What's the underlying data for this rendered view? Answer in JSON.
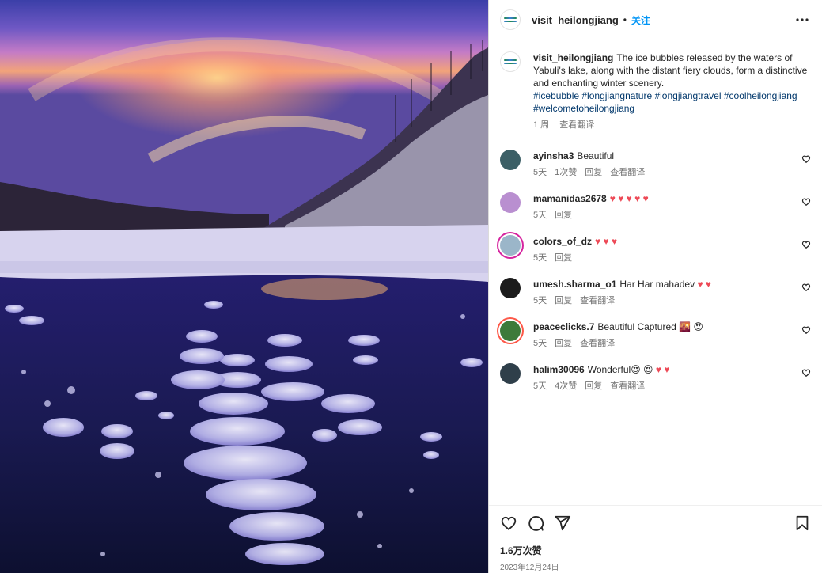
{
  "account": {
    "username": "visit_heilongjiang",
    "follow_label": "关注"
  },
  "caption": {
    "username": "visit_heilongjiang",
    "text": "The ice bubbles released by the waters of Yabuli's lake, along with the distant fiery clouds, form a distinctive and enchanting winter scenery.",
    "hashtags": "#icebubble #longjiangnature #longjiangtravel #coolheilongjiang #welcometoheilongjiang",
    "time": "1 周",
    "translate_label": "查看翻译"
  },
  "comments": [
    {
      "username": "ayinsha3",
      "text": "Beautiful",
      "time": "5天",
      "likes": "1次赞",
      "reply": "回复",
      "translate": "查看翻译",
      "avatar_color": "#3c5f66"
    },
    {
      "username": "mamanidas2678",
      "text": "♥ ♥ ♥ ♥ ♥",
      "time": "5天",
      "likes": "",
      "reply": "回复",
      "translate": "",
      "avatar_color": "#b98fd0"
    },
    {
      "username": "colors_of_dz",
      "text": "♥ ♥ ♥",
      "time": "5天",
      "likes": "",
      "reply": "回复",
      "translate": "",
      "avatar_color": "#9bb6c9"
    },
    {
      "username": "umesh.sharma_o1",
      "text": "Har Har mahadev ♥ ♥",
      "time": "5天",
      "likes": "",
      "reply": "回复",
      "translate": "查看翻译",
      "avatar_color": "#1c1c1c"
    },
    {
      "username": "peaceclicks.7",
      "text": "Beautiful Captured 🌇 😍",
      "time": "5天",
      "likes": "",
      "reply": "回复",
      "translate": "查看翻译",
      "avatar_color": "#3d7a3a"
    },
    {
      "username": "halim30096",
      "text": "Wonderful😍 😍 ♥ ♥",
      "time": "5天",
      "likes": "4次赞",
      "reply": "回复",
      "translate": "查看翻译",
      "avatar_color": "#2f3f4a"
    }
  ],
  "footer": {
    "likes": "1.6万次赞",
    "date": "2023年12月24日"
  },
  "icons": {
    "more": "more-horizontal-icon",
    "like": "heart-outline-icon",
    "comment": "comment-bubble-icon",
    "share": "paper-plane-icon",
    "save": "bookmark-icon",
    "comment_like": "small-heart-icon"
  },
  "colors": {
    "link": "#0095f6",
    "hashtag": "#00376b",
    "heart": "#ed4956",
    "muted": "#737373"
  }
}
